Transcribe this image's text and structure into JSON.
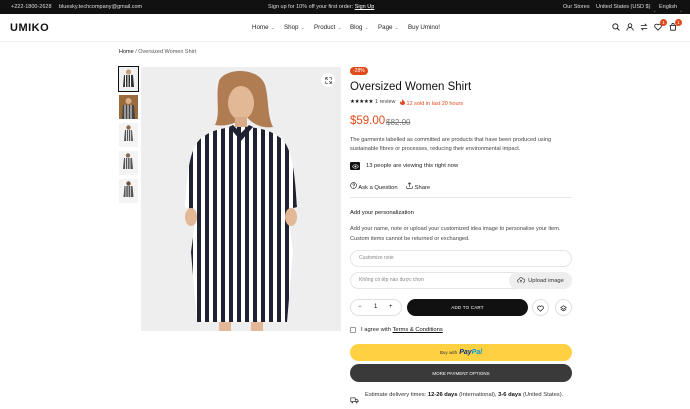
{
  "topbar": {
    "phone": "+222-1800-2628",
    "email": "bluesky.techcompany@gmail.com",
    "promo": "Sign up for 10% off your first order:",
    "promo_link": "Sign Up",
    "stores": "Our Stores",
    "currency": "United States (USD $)",
    "language": "English"
  },
  "header": {
    "logo": "UMIKO",
    "nav": [
      "Home",
      "Shop",
      "Product",
      "Blog",
      "Page",
      "Buy Umino!"
    ],
    "wishlist_count": "1",
    "cart_count": "1"
  },
  "breadcrumb": {
    "home": "Home",
    "sep": "/",
    "current": "Oversized Women Shirt"
  },
  "product": {
    "sale_badge": "-28%",
    "title": "Oversized Women Shirt",
    "stars": "★★★★★",
    "review_text": "1 review",
    "sold_text": "12 sold in last 20 hours",
    "price": "$59.00",
    "old_price": "$82.00",
    "description": "The garments labelled as committed are products that have been produced using sustainable fibres or processes, reducing their environmental impact.",
    "viewing": "13 people are viewing this right now",
    "ask": "Ask a Question",
    "share": "Share",
    "personalization_title": "Add your personalization",
    "personalization_text": "Add your name, note or upload your customized idea image to personalise your item. Custom items cannot be returned or exchanged.",
    "note_placeholder": "Customize note",
    "no_file": "Không có tệp nào được chọn",
    "upload_label": "Upload image",
    "quantity": "1",
    "minus": "−",
    "plus": "+",
    "add_to_cart": "ADD TO CART",
    "agree_text": "I agree with",
    "terms": "Terms & Conditions",
    "buy_with": "Buy with",
    "paypal_a": "Pay",
    "paypal_b": "Pal",
    "more_payment": "MORE PAYMENT OPTIONS",
    "estimate_label": "Estimate delivery times:",
    "estimate_intl_days": "12-26 days",
    "estimate_intl": "(International),",
    "estimate_us_days": "3-6 days",
    "estimate_us": "(United States)."
  },
  "colors": {
    "accent": "#e04a1a",
    "dark": "#111111",
    "paypal": "#ffd142"
  }
}
